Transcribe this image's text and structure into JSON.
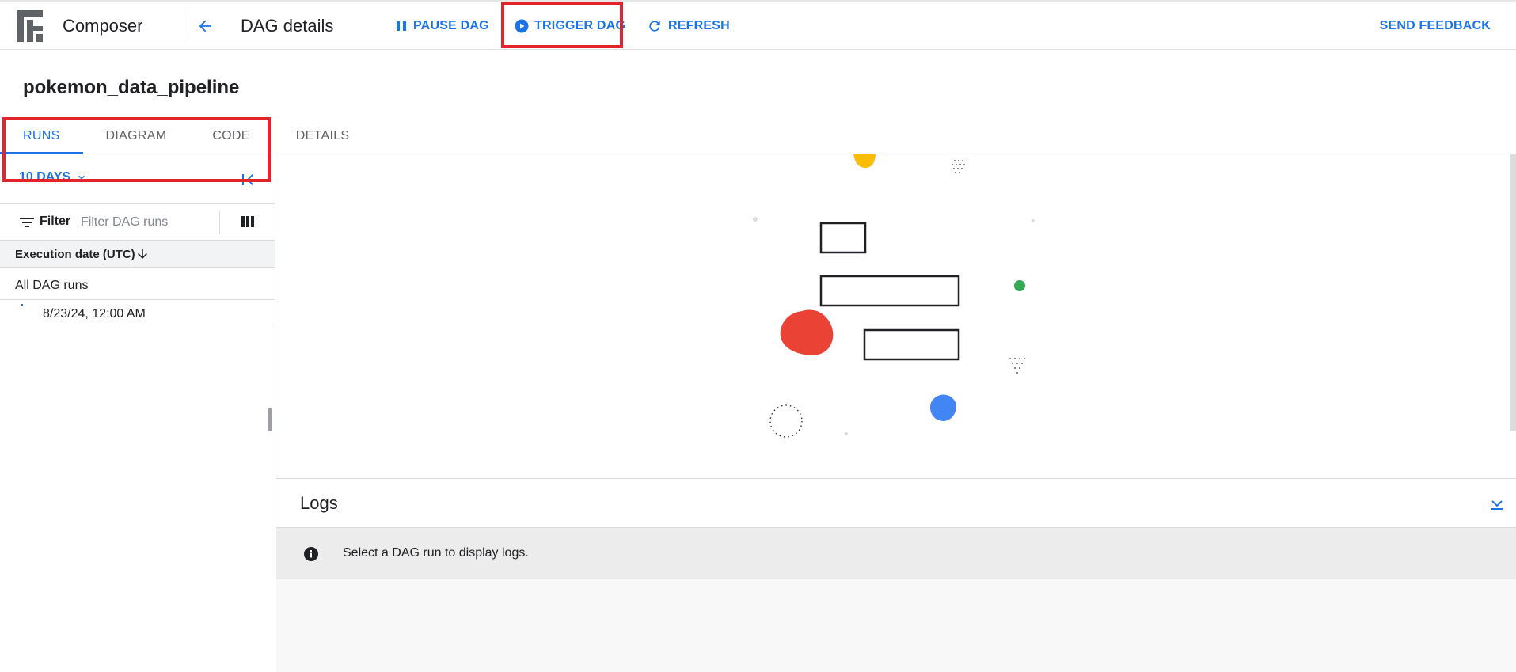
{
  "header": {
    "app_title": "Composer",
    "page_title": "DAG details",
    "pause_label": "PAUSE DAG",
    "trigger_label": "TRIGGER DAG",
    "refresh_label": "REFRESH",
    "feedback_label": "SEND FEEDBACK"
  },
  "dag": {
    "name": "pokemon_data_pipeline"
  },
  "tabs": [
    {
      "label": "RUNS",
      "active": true
    },
    {
      "label": "DIAGRAM",
      "active": false
    },
    {
      "label": "CODE",
      "active": false
    },
    {
      "label": "DETAILS",
      "active": false
    }
  ],
  "runs_panel": {
    "range_label": "10 DAYS",
    "filter_label": "Filter",
    "filter_placeholder": "Filter DAG runs",
    "column_header": "Execution date (UTC)",
    "rows": [
      {
        "label": "All DAG runs"
      },
      {
        "label": "8/23/24, 12:00 AM"
      }
    ]
  },
  "logs": {
    "title": "Logs",
    "empty_message": "Select a DAG run to display logs."
  },
  "colors": {
    "accent": "#1a73e8",
    "highlight": "#e3242b",
    "shape_yellow": "#fbbc04",
    "shape_red": "#ea4335",
    "shape_green": "#34a853",
    "shape_blue": "#4285f4"
  },
  "icons": [
    "logo-icon",
    "back-arrow-icon",
    "pause-icon",
    "play-circle-icon",
    "refresh-icon",
    "chevron-down-icon",
    "collapse-panel-icon",
    "filter-icon",
    "columns-icon",
    "arrow-down-icon",
    "expand-more-icon",
    "info-icon"
  ]
}
